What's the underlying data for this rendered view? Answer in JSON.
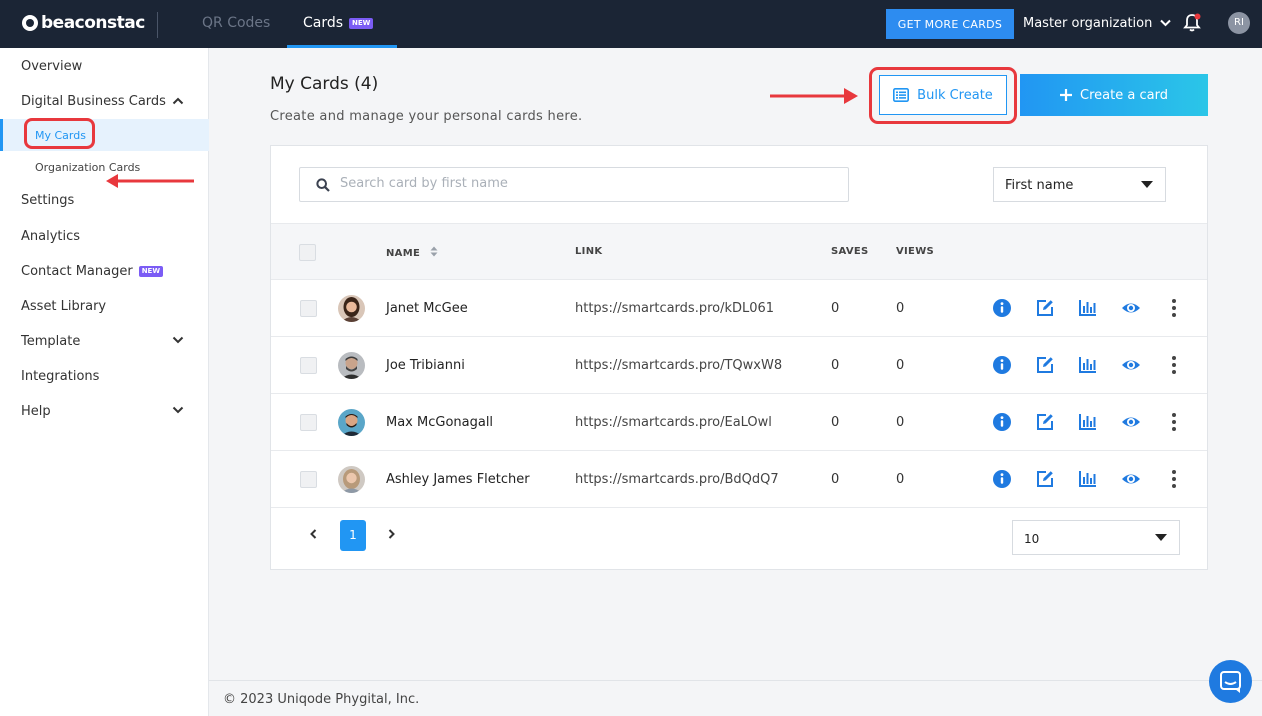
{
  "brand": {
    "name": "beaconstac"
  },
  "topnav": {
    "tabs": [
      {
        "label": "QR Codes"
      },
      {
        "label": "Cards",
        "badge": "NEW"
      }
    ],
    "cta_label": "GET MORE CARDS",
    "org_label": "Master organization",
    "user_initials": "RI"
  },
  "sidebar": {
    "overview": "Overview",
    "digital_business_cards": "Digital Business Cards",
    "my_cards": "My Cards",
    "organization_cards": "Organization Cards",
    "settings": "Settings",
    "analytics": "Analytics",
    "contact_manager": "Contact Manager",
    "contact_manager_badge": "NEW",
    "asset_library": "Asset Library",
    "template": "Template",
    "integrations": "Integrations",
    "help": "Help"
  },
  "page": {
    "title": "My Cards (4)",
    "subtitle": "Create and manage your personal cards here.",
    "bulk_create_label": "Bulk Create",
    "create_card_label": "Create a card"
  },
  "search": {
    "placeholder": "Search card by first name",
    "value": ""
  },
  "sort": {
    "selected": "First name"
  },
  "table": {
    "columns": {
      "name": "NAME",
      "link": "LINK",
      "saves": "SAVES",
      "views": "VIEWS"
    },
    "rows": [
      {
        "name": "Janet McGee",
        "link": "https://smartcards.pro/kDL061",
        "saves": "0",
        "views": "0"
      },
      {
        "name": "Joe Tribianni",
        "link": "https://smartcards.pro/TQwxW8",
        "saves": "0",
        "views": "0"
      },
      {
        "name": "Max McGonagall",
        "link": "https://smartcards.pro/EaLOwl",
        "saves": "0",
        "views": "0"
      },
      {
        "name": "Ashley James Fletcher",
        "link": "https://smartcards.pro/BdQdQ7",
        "saves": "0",
        "views": "0"
      }
    ]
  },
  "pagination": {
    "current_page": "1",
    "per_page": "10"
  },
  "footer": {
    "copyright": "© 2023 Uniqode Phygital, Inc."
  },
  "colors": {
    "accent": "#2196f3",
    "topbar": "#1b2535",
    "highlight": "#e8383d",
    "badge": "#7b5cf5"
  },
  "icons": [
    "search-icon",
    "info-icon",
    "edit-icon",
    "analytics-icon",
    "view-icon",
    "more-icon",
    "bell-icon",
    "chevron-down-icon",
    "chevron-up-icon",
    "list-icon",
    "plus-icon",
    "chat-icon"
  ]
}
